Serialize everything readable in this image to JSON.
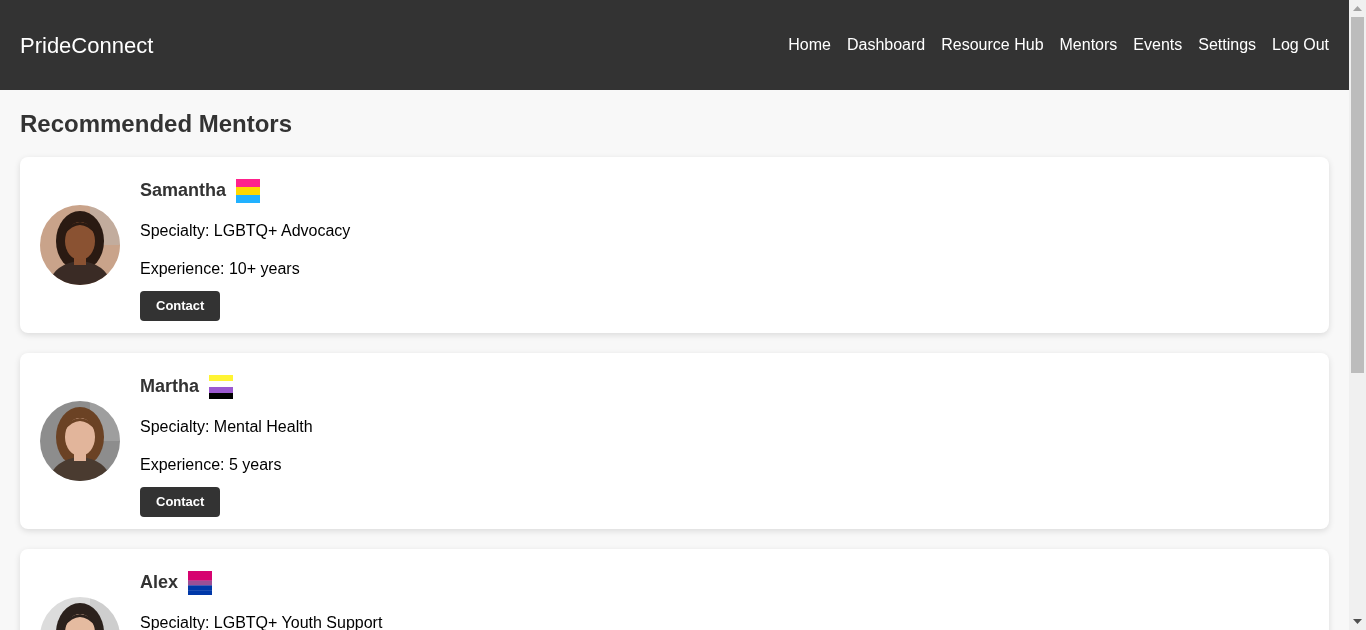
{
  "header": {
    "brand": "PrideConnect",
    "nav": [
      "Home",
      "Dashboard",
      "Resource Hub",
      "Mentors",
      "Events",
      "Settings",
      "Log Out"
    ]
  },
  "section_title": "Recommended Mentors",
  "mentors": [
    {
      "name": "Samantha",
      "flag": {
        "kind": "pansexual"
      },
      "specialty": "Specialty: LGBTQ+ Advocacy",
      "experience": "Experience: 10+ years",
      "button": "Contact"
    },
    {
      "name": "Martha",
      "flag": {
        "kind": "nonbinary"
      },
      "specialty": "Specialty: Mental Health",
      "experience": "Experience: 5 years",
      "button": "Contact"
    },
    {
      "name": "Alex",
      "flag": {
        "kind": "bisexual"
      },
      "specialty": "Specialty: LGBTQ+ Youth Support"
    }
  ]
}
